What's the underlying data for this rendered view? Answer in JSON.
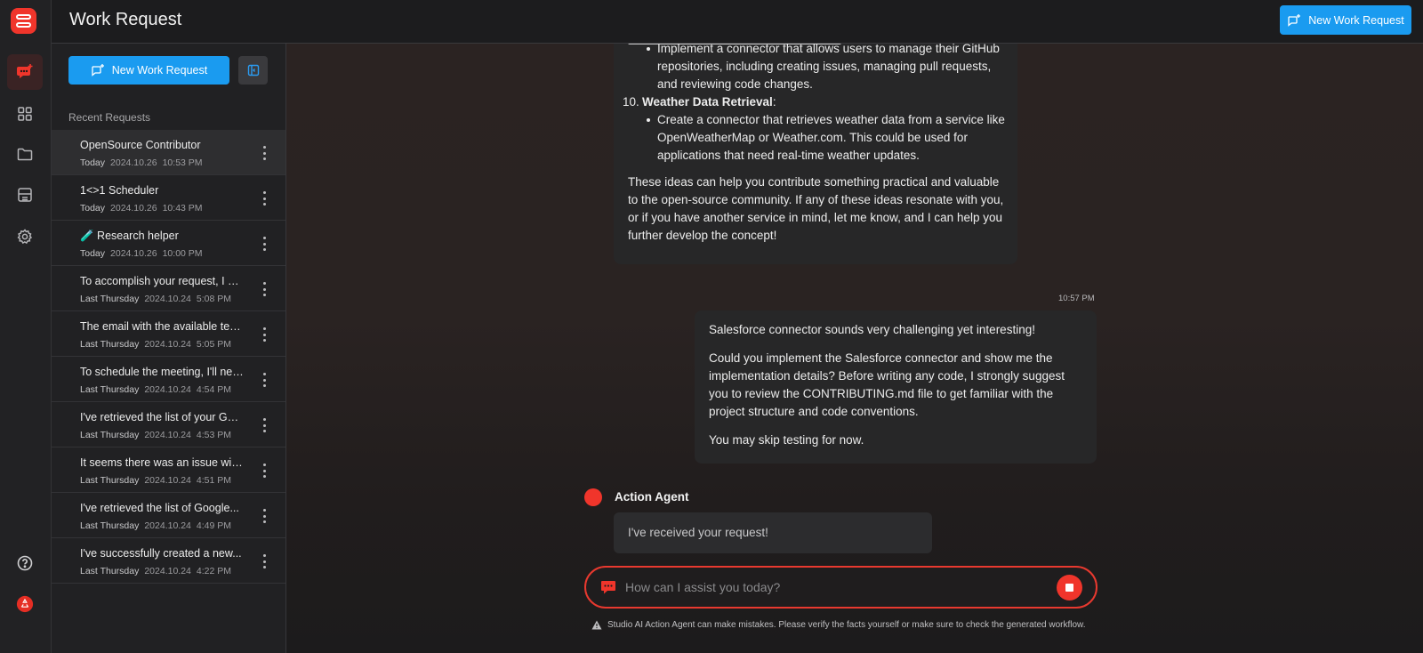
{
  "app": {
    "title": "Work Request"
  },
  "header": {
    "new_request_label": "New Work Request"
  },
  "sidebar": {
    "new_request_label": "New Work Request",
    "recent_title": "Recent Requests",
    "requests": [
      {
        "title": "OpenSource Contributor",
        "day": "Today",
        "date": "2024.10.26",
        "time": "10:53 PM"
      },
      {
        "title": "1<>1 Scheduler",
        "day": "Today",
        "date": "2024.10.26",
        "time": "10:43 PM"
      },
      {
        "title": "🧪 Research helper",
        "day": "Today",
        "date": "2024.10.26",
        "time": "10:00 PM"
      },
      {
        "title": "To accomplish your request, I will...",
        "day": "Last Thursday",
        "date": "2024.10.24",
        "time": "5:08 PM"
      },
      {
        "title": "The email with the available team...",
        "day": "Last Thursday",
        "date": "2024.10.24",
        "time": "5:05 PM"
      },
      {
        "title": "To schedule the meeting, I'll need ...",
        "day": "Last Thursday",
        "date": "2024.10.24",
        "time": "4:54 PM"
      },
      {
        "title": "I've retrieved the list of your Googl...",
        "day": "Last Thursday",
        "date": "2024.10.24",
        "time": "4:53 PM"
      },
      {
        "title": "It seems there was an issue with...",
        "day": "Last Thursday",
        "date": "2024.10.24",
        "time": "4:51 PM"
      },
      {
        "title": "I've retrieved the list of Google...",
        "day": "Last Thursday",
        "date": "2024.10.24",
        "time": "4:49 PM"
      },
      {
        "title": "I've successfully created a new...",
        "day": "Last Thursday",
        "date": "2024.10.24",
        "time": "4:22 PM"
      }
    ]
  },
  "chat": {
    "ai_message": {
      "item9_bullet": "Implement a connector that allows users to manage their GitHub repositories, including creating issues, managing pull requests, and reviewing code changes.",
      "item10_number": "10.",
      "item10_title": "Weather Data Retrieval",
      "item10_colon": ":",
      "item10_bullet": "Create a connector that retrieves weather data from a service like OpenWeatherMap or Weather.com. This could be used for applications that need real-time weather updates.",
      "closing": "These ideas can help you contribute something practical and valuable to the open-source community. If any of these ideas resonate with you, or if you have another service in mind, let me know, and I can help you further develop the concept!"
    },
    "user_timestamp": "10:57 PM",
    "user_message": {
      "p1": "Salesforce connector sounds very challenging yet interesting!",
      "p2": "Could you implement the Salesforce connector and show me the implementation details? Before writing any code, I strongly suggest you to review the CONTRIBUTING.md file to get familiar with the project structure and  code conventions.",
      "p3": "You may skip testing for now."
    },
    "agent_name": "Action Agent",
    "agent_reply": "I've received your request!",
    "input_placeholder": "How can I assist you today?",
    "disclaimer": "Studio AI Action Agent can make mistakes. Please verify the facts yourself or make sure to check the generated workflow."
  },
  "colors": {
    "accent_red": "#f0352b",
    "button_blue": "#1a9bf0"
  }
}
